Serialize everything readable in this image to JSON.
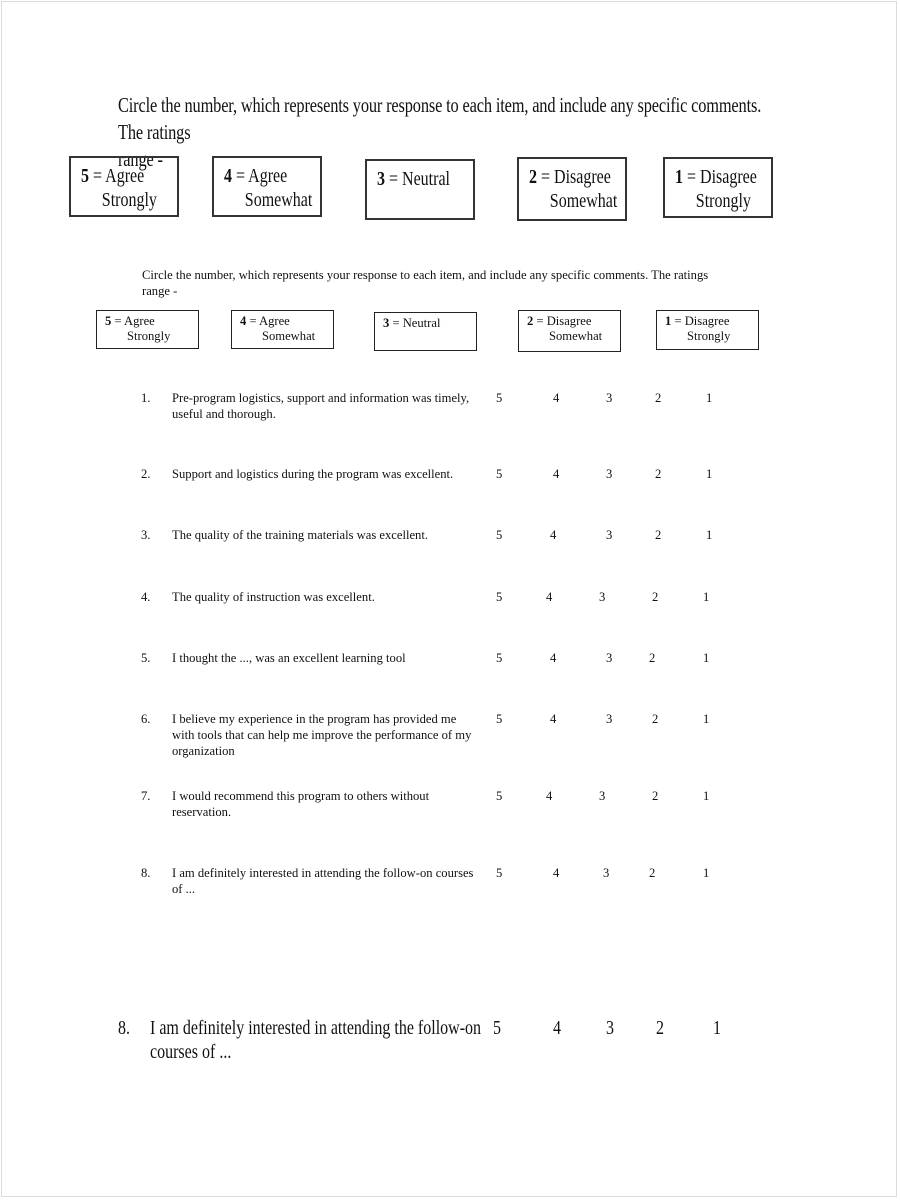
{
  "large_header": {
    "instruction_line1": "Circle the number, which represents your response to each item, and include any specific comments.  The ratings",
    "instruction_line2": "range  -",
    "scale": [
      {
        "num": "5",
        "eq": " = Agree",
        "line2": "Strongly"
      },
      {
        "num": "4",
        "eq": " = Agree",
        "line2": "Somewhat"
      },
      {
        "num": "3",
        "eq": " = Neutral",
        "line2": ""
      },
      {
        "num": "2",
        "eq": " = Disagree",
        "line2": "Somewhat"
      },
      {
        "num": "1",
        "eq": " = Disagree",
        "line2": "Strongly"
      }
    ]
  },
  "small_header": {
    "instruction_line1": "Circle the number, which represents your response to each item, and include any specific comments.  The ratings",
    "instruction_line2": "range  -",
    "scale": [
      {
        "num": "5",
        "eq": " = Agree",
        "line2": "Strongly"
      },
      {
        "num": "4",
        "eq": " = Agree",
        "line2": "Somewhat"
      },
      {
        "num": "3",
        "eq": " = Neutral",
        "line2": ""
      },
      {
        "num": "2",
        "eq": " = Disagree",
        "line2": "Somewhat"
      },
      {
        "num": "1",
        "eq": " = Disagree",
        "line2": "Strongly"
      }
    ]
  },
  "questions": [
    {
      "num": "1.",
      "text": "Pre-program logistics, support and information was timely, useful and thorough.",
      "ratings": [
        "5",
        "4",
        "3",
        "2",
        "1"
      ]
    },
    {
      "num": "2.",
      "text": "Support and logistics during the program was excellent.",
      "ratings": [
        "5",
        "4",
        "3",
        "2",
        "1"
      ]
    },
    {
      "num": "3.",
      "text": "The quality of the training materials was excellent.",
      "ratings": [
        "5",
        "4",
        "3",
        "2",
        "1"
      ]
    },
    {
      "num": "4.",
      "text": "The quality of instruction was excellent.",
      "ratings": [
        "5",
        "4",
        "3",
        "2",
        "1"
      ]
    },
    {
      "num": "5.",
      "text": "I thought the ...,  was an excellent learning tool",
      "ratings": [
        "5",
        "4",
        "3",
        "2",
        "1"
      ]
    },
    {
      "num": "6.",
      "text": "I believe my experience in the program has provided me with tools that can help me improve the performance of my organization",
      "ratings": [
        "5",
        "4",
        "3",
        "2",
        "1"
      ]
    },
    {
      "num": "7.",
      "text": "I would recommend this program to others without reservation.",
      "ratings": [
        "5",
        "4",
        "3",
        "2",
        "1"
      ]
    },
    {
      "num": "8.",
      "text": "I am definitely interested in attending the follow-on courses of ...",
      "ratings": [
        "5",
        "4",
        "3",
        "2",
        "1"
      ]
    }
  ],
  "large_question": {
    "num": "8.",
    "text_line1": "I am definitely interested in attending the follow-on",
    "text_line2": "courses of ...",
    "ratings": [
      "5",
      "4",
      "3",
      "2",
      "1"
    ]
  }
}
